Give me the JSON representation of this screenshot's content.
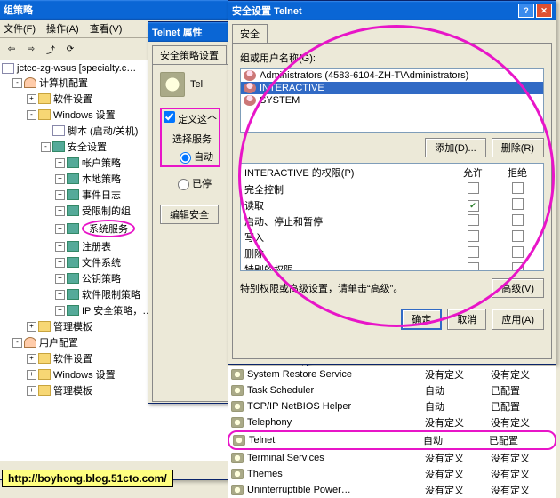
{
  "gpedit": {
    "title": "组策略",
    "menu": [
      "文件(F)",
      "操作(A)",
      "查看(V)"
    ],
    "root": "jctco-zg-wsus [specialty.c…",
    "tree": [
      {
        "ind": 12,
        "tgl": "-",
        "icn": "user",
        "label": "计算机配置"
      },
      {
        "ind": 28,
        "tgl": "+",
        "icn": "folder",
        "label": "软件设置"
      },
      {
        "ind": 28,
        "tgl": "-",
        "icn": "folder",
        "label": "Windows 设置"
      },
      {
        "ind": 44,
        "tgl": "",
        "icn": "page",
        "label": "脚本 (启动/关机)"
      },
      {
        "ind": 44,
        "tgl": "-",
        "icn": "book",
        "label": "安全设置"
      },
      {
        "ind": 60,
        "tgl": "+",
        "icn": "book",
        "label": "帐户策略"
      },
      {
        "ind": 60,
        "tgl": "+",
        "icn": "book",
        "label": "本地策略"
      },
      {
        "ind": 60,
        "tgl": "+",
        "icn": "book",
        "label": "事件日志"
      },
      {
        "ind": 60,
        "tgl": "+",
        "icn": "book",
        "label": "受限制的组"
      },
      {
        "ind": 60,
        "tgl": "+",
        "icn": "book",
        "label": "系统服务",
        "hl": true
      },
      {
        "ind": 60,
        "tgl": "+",
        "icn": "book",
        "label": "注册表"
      },
      {
        "ind": 60,
        "tgl": "+",
        "icn": "book",
        "label": "文件系统"
      },
      {
        "ind": 60,
        "tgl": "+",
        "icn": "book",
        "label": "公钥策略"
      },
      {
        "ind": 60,
        "tgl": "+",
        "icn": "book",
        "label": "软件限制策略"
      },
      {
        "ind": 60,
        "tgl": "+",
        "icn": "book",
        "label": "IP 安全策略，…"
      },
      {
        "ind": 28,
        "tgl": "+",
        "icn": "folder",
        "label": "管理模板"
      },
      {
        "ind": 12,
        "tgl": "-",
        "icn": "user",
        "label": "用户配置"
      },
      {
        "ind": 28,
        "tgl": "+",
        "icn": "folder",
        "label": "软件设置"
      },
      {
        "ind": 28,
        "tgl": "+",
        "icn": "folder",
        "label": "Windows 设置"
      },
      {
        "ind": 28,
        "tgl": "+",
        "icn": "folder",
        "label": "管理模板"
      }
    ]
  },
  "telnetprops": {
    "title": "Telnet 属性",
    "tab": "安全策略设置",
    "service_label": "Tel",
    "define_chk": "定义这个",
    "define_checked": true,
    "select_label": "选择服务",
    "radios": [
      "自动",
      "已停"
    ],
    "radio_selected": 0,
    "edit_btn": "编辑安全"
  },
  "secdlg": {
    "title": "安全设置 Telnet",
    "tab": "安全",
    "groups_label": "组或用户名称(G):",
    "groups": [
      {
        "label": "Administrators (4583-6104-ZH-T\\Administrators)",
        "sel": false
      },
      {
        "label": "INTERACTIVE",
        "sel": true
      },
      {
        "label": "SYSTEM",
        "sel": false
      }
    ],
    "add_btn": "添加(D)...",
    "remove_btn": "删除(R)",
    "perm_label": "INTERACTIVE 的权限(P)",
    "allow": "允许",
    "deny": "拒绝",
    "perms": [
      {
        "name": "完全控制",
        "allow": false,
        "deny": false
      },
      {
        "name": "读取",
        "allow": true,
        "deny": false
      },
      {
        "name": "启动、停止和暂停",
        "allow": false,
        "deny": false
      },
      {
        "name": "写入",
        "allow": false,
        "deny": false
      },
      {
        "name": "删除",
        "allow": false,
        "deny": false
      },
      {
        "name": "特别的权限",
        "allow": false,
        "deny": false
      }
    ],
    "special_text": "特别权限或高级设置，请单击“高级”。",
    "advanced_btn": "高级(V)",
    "ok": "确定",
    "cancel": "取消",
    "apply": "应用(A)"
  },
  "services": [
    {
      "name": "System Restore Service",
      "c2": "没有定义",
      "c3": "没有定义"
    },
    {
      "name": "Task Scheduler",
      "c2": "自动",
      "c3": "已配置"
    },
    {
      "name": "TCP/IP NetBIOS Helper",
      "c2": "自动",
      "c3": "已配置"
    },
    {
      "name": "Telephony",
      "c2": "没有定义",
      "c3": "没有定义"
    },
    {
      "name": "Telnet",
      "c2": "自动",
      "c3": "已配置",
      "hl": true
    },
    {
      "name": "Terminal Services",
      "c2": "没有定义",
      "c3": "没有定义"
    },
    {
      "name": "Themes",
      "c2": "没有定义",
      "c3": "没有定义"
    },
    {
      "name": "Uninterruptible Power…",
      "c2": "没有定义",
      "c3": "没有定义"
    }
  ],
  "url": "http://boyhong.blog.51cto.com/"
}
